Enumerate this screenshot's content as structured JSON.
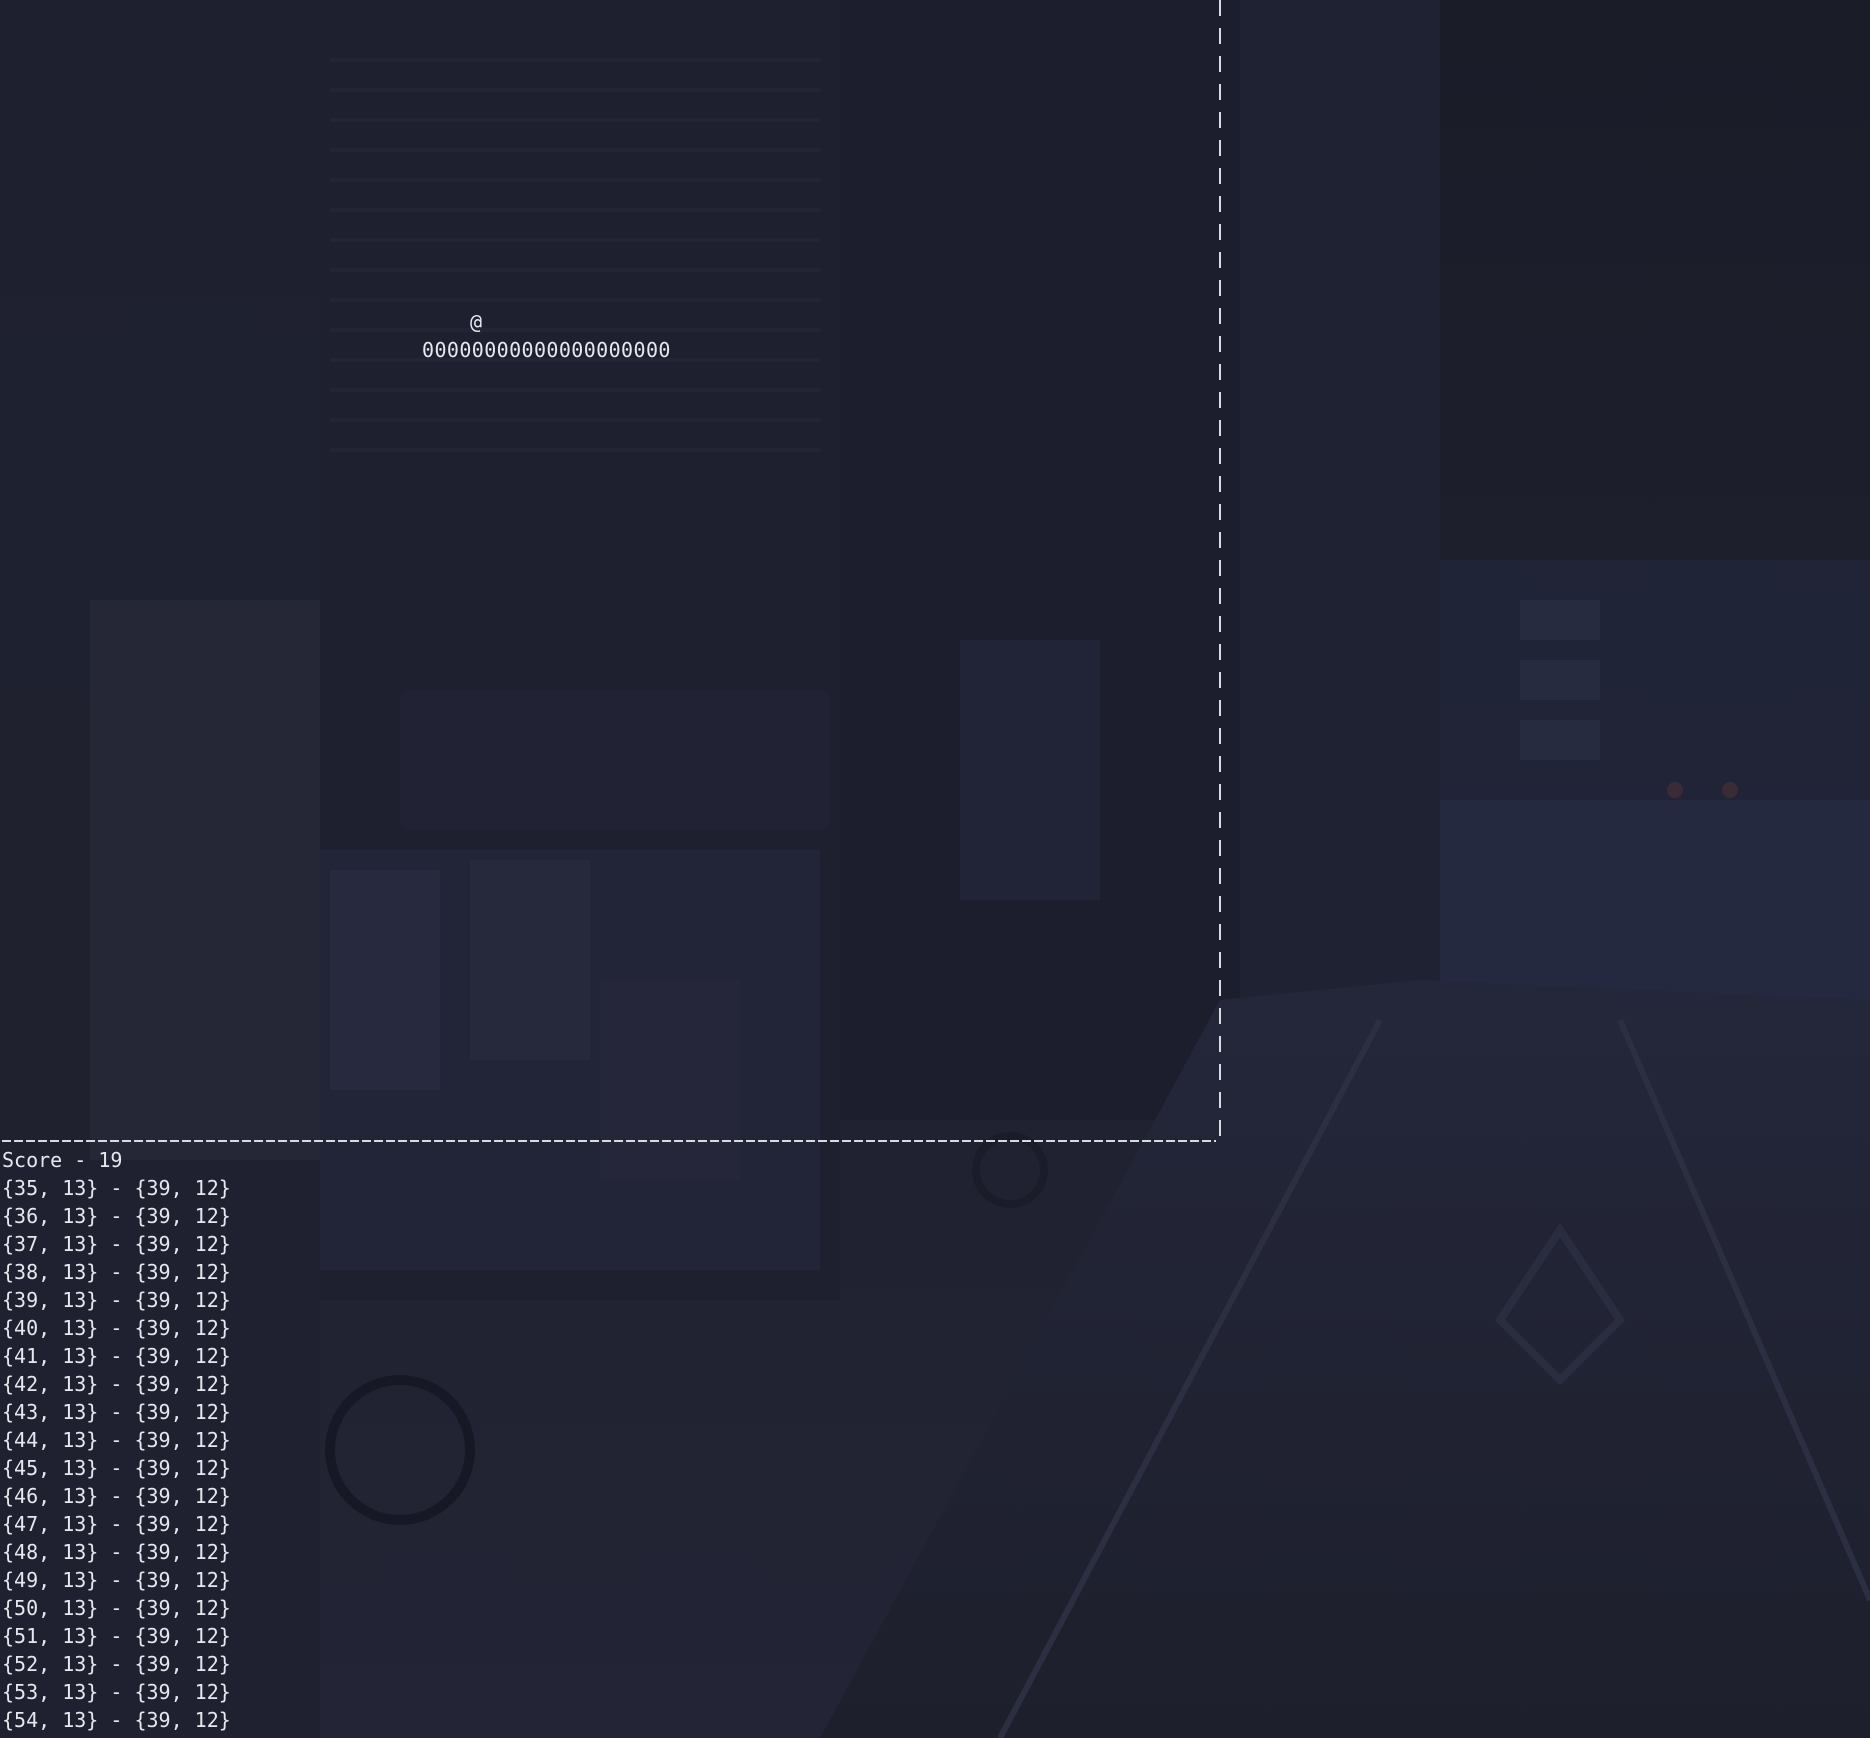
{
  "game": {
    "snake_head": "@",
    "snake_body": "00000000000000000000",
    "score_text": "Score - 19"
  },
  "log": [
    "{35, 13} - {39, 12}",
    "{36, 13} - {39, 12}",
    "{37, 13} - {39, 12}",
    "{38, 13} - {39, 12}",
    "{39, 13} - {39, 12}",
    "{40, 13} - {39, 12}",
    "{41, 13} - {39, 12}",
    "{42, 13} - {39, 12}",
    "{43, 13} - {39, 12}",
    "{44, 13} - {39, 12}",
    "{45, 13} - {39, 12}",
    "{46, 13} - {39, 12}",
    "{47, 13} - {39, 12}",
    "{48, 13} - {39, 12}",
    "{49, 13} - {39, 12}",
    "{50, 13} - {39, 12}",
    "{51, 13} - {39, 12}",
    "{52, 13} - {39, 12}",
    "{53, 13} - {39, 12}",
    "{54, 13} - {39, 12}"
  ],
  "colors": {
    "background": "#1c1e2c",
    "text": "#e6e8ef",
    "border": "#d8dae2"
  }
}
